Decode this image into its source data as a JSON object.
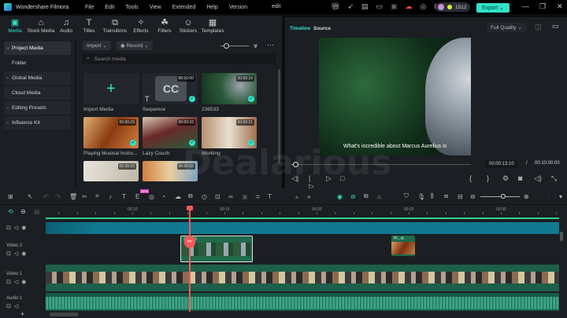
{
  "app": {
    "name": "Wondershare Filmora",
    "project_title": "edit",
    "menu": [
      "File",
      "Edit",
      "Tools",
      "View",
      "Extended",
      "Help",
      "Version"
    ],
    "credits": "1512",
    "export_label": "Export",
    "accent": "#2fe3c6"
  },
  "toolbar_tabs": [
    {
      "label": "Media",
      "icon": "media-icon",
      "active": true
    },
    {
      "label": "Stock Media",
      "icon": "stock-icon"
    },
    {
      "label": "Audio",
      "icon": "music-icon"
    },
    {
      "label": "Titles",
      "icon": "text-icon"
    },
    {
      "label": "Transitions",
      "icon": "transition-icon"
    },
    {
      "label": "Effects",
      "icon": "effects-icon"
    },
    {
      "label": "Filters",
      "icon": "filters-icon"
    },
    {
      "label": "Stickers",
      "icon": "sticker-icon"
    },
    {
      "label": "Templates",
      "icon": "template-icon"
    }
  ],
  "sidebar": [
    {
      "label": "Project Media",
      "expand": true,
      "active": true
    },
    {
      "label": "Folder"
    },
    {
      "label": "Global Media",
      "expand": true
    },
    {
      "label": "Cloud Media"
    },
    {
      "label": "Editing Presets",
      "expand": true
    },
    {
      "label": "Influence Kit",
      "expand": true
    }
  ],
  "media": {
    "import_label": "Import",
    "record_label": "Record",
    "search_placeholder": "Search media",
    "items": [
      {
        "label": "Import Media",
        "type": "import"
      },
      {
        "label": "Sequence",
        "duration": "00:10:00",
        "type": "cc"
      },
      {
        "label": "236533",
        "duration": "00:00:10"
      },
      {
        "label": "Playing Musical Instru...",
        "duration": "00:00:29"
      },
      {
        "label": "Lazy Couch",
        "duration": "00:00:33"
      },
      {
        "label": "Working",
        "duration": "00:00:21"
      },
      {
        "label": "",
        "duration": "00:00:20"
      },
      {
        "label": "",
        "duration": "00:00:59"
      }
    ]
  },
  "preview": {
    "tabs": [
      "Timeline",
      "Source"
    ],
    "quality": "Full Quality",
    "subtitle": "What's incredible about Marcus Aurelius is",
    "current_time": "00:00:13:10",
    "separator": "/",
    "total_time": "00:10:00:00",
    "progress": 0.02
  },
  "timeline": {
    "ruler": [
      "00:10",
      "00:15",
      "00:20",
      "00:25",
      "00:30"
    ],
    "new_badge": "NEW",
    "tracks": [
      {
        "label": ""
      },
      {
        "label": "Video 2"
      },
      {
        "label": "Video 1"
      },
      {
        "label": "Audio 1"
      }
    ],
    "clips": [
      {
        "track": "Video 2",
        "label": "236533"
      },
      {
        "track": "Video 2",
        "label": "Pl...nt"
      }
    ]
  },
  "watermark": "Dealarious"
}
